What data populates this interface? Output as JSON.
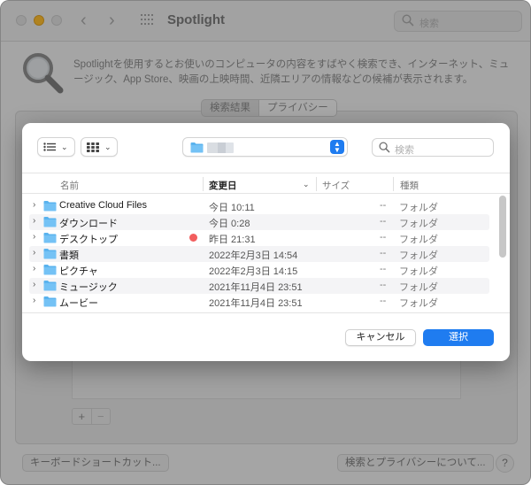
{
  "window": {
    "title": "Spotlight",
    "search_placeholder": "検索",
    "description": "Spotlightを使用するとお使いのコンピュータの内容をすばやく検索でき、インターネット、ミュージック、App Store、映画の上映時間、近隣エリアの情報などの候補が表示されます。",
    "tabs": [
      "検索結果",
      "プライバシー"
    ],
    "selected_tab": "プライバシー",
    "add_button": "+",
    "remove_button": "−",
    "shortcut_button": "キーボードショートカット...",
    "privacy_button": "検索とプライバシーについて...",
    "help_button": "?"
  },
  "dialog": {
    "search_placeholder": "検索",
    "columns": {
      "name": "名前",
      "date": "変更日",
      "size": "サイズ",
      "kind": "種類"
    },
    "rows": [
      {
        "name": "Creative Cloud Files",
        "date": "今日 10:11",
        "size": "--",
        "kind": "フォルダ",
        "tag": false
      },
      {
        "name": "ダウンロード",
        "date": "今日 0:28",
        "size": "--",
        "kind": "フォルダ",
        "tag": false
      },
      {
        "name": "デスクトップ",
        "date": "昨日 21:31",
        "size": "--",
        "kind": "フォルダ",
        "tag": true
      },
      {
        "name": "書類",
        "date": "2022年2月3日 14:54",
        "size": "--",
        "kind": "フォルダ",
        "tag": false
      },
      {
        "name": "ピクチャ",
        "date": "2022年2月3日 14:15",
        "size": "--",
        "kind": "フォルダ",
        "tag": false
      },
      {
        "name": "ミュージック",
        "date": "2021年11月4日 23:51",
        "size": "--",
        "kind": "フォルダ",
        "tag": false
      },
      {
        "name": "ムービー",
        "date": "2021年11月4日 23:51",
        "size": "--",
        "kind": "フォルダ",
        "tag": false
      }
    ],
    "cancel_label": "キャンセル",
    "select_label": "選択"
  },
  "colors": {
    "accent": "#1f7cf0",
    "folder": "#5ab3ee",
    "tag_red": "#f25e5e"
  }
}
